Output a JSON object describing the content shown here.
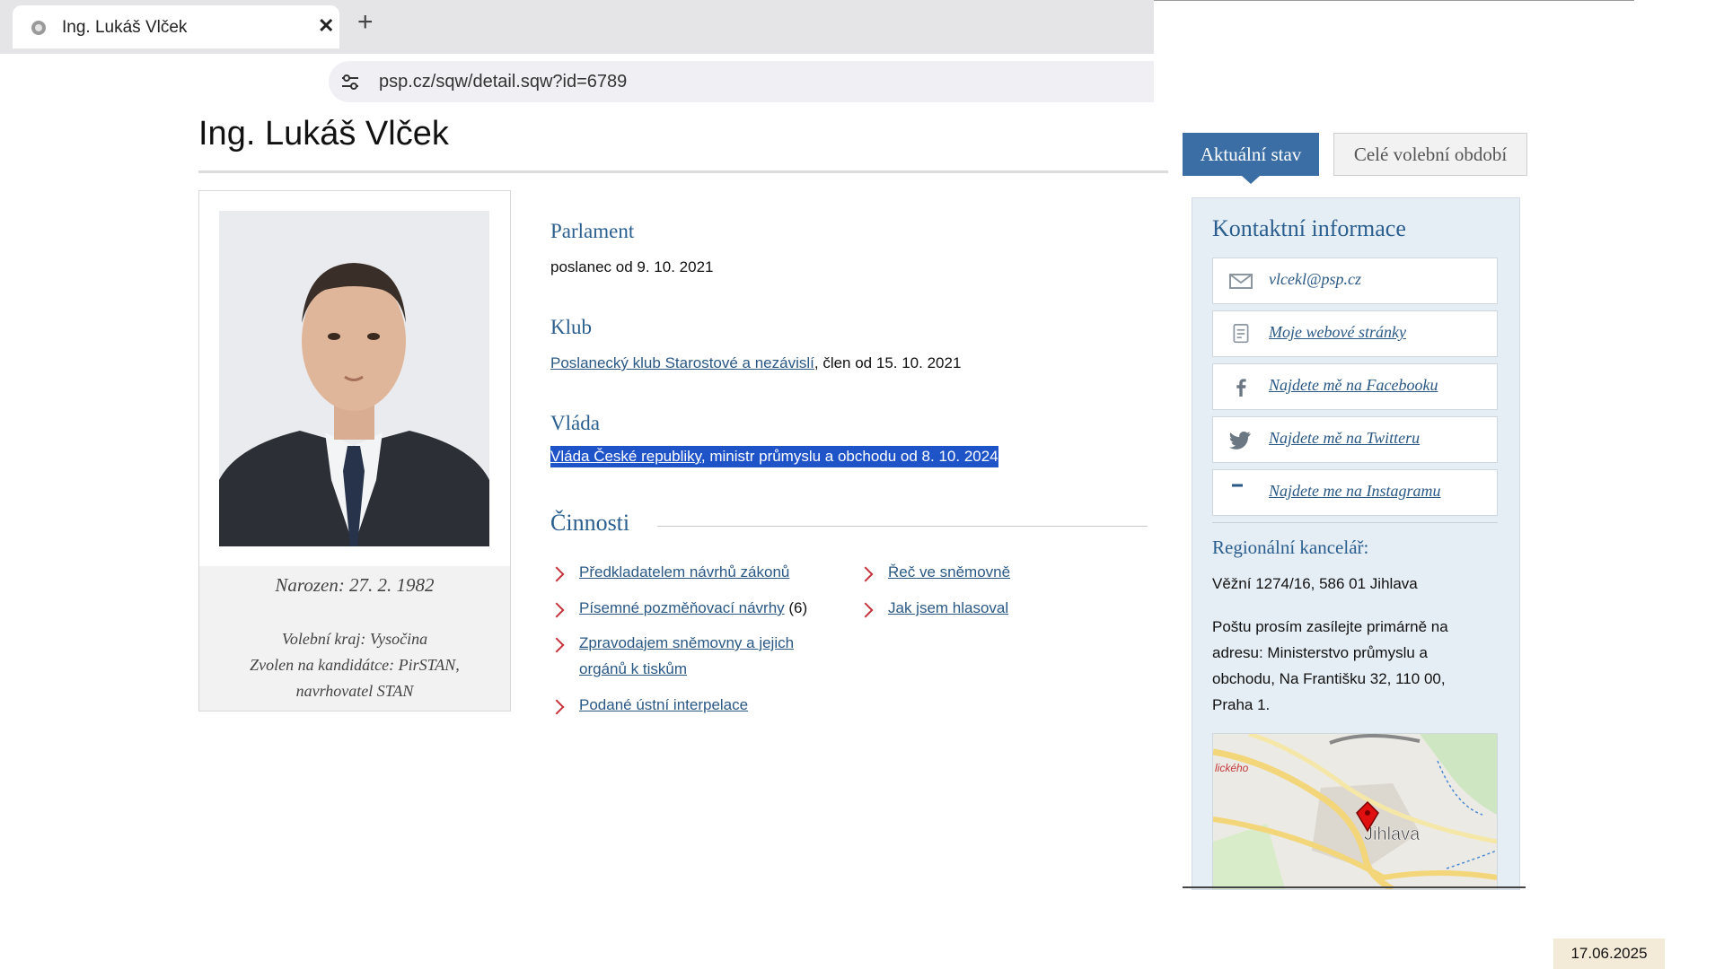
{
  "browser": {
    "tab_title": "Ing. Lukáš Vlček",
    "url": "psp.cz/sqw/detail.sqw?id=6789"
  },
  "page": {
    "title": "Ing. Lukáš Vlček"
  },
  "profile": {
    "born": "Narozen: 27. 2. 1982",
    "constituency": "Volební kraj: Vysočina",
    "candidate_of": "Zvolen na kandidátce: PirSTAN,",
    "nominated_by": "navrhovatel STAN"
  },
  "parliament": {
    "heading": "Parlament",
    "text": "poslanec od 9. 10. 2021"
  },
  "club": {
    "heading": "Klub",
    "link": "Poslanecký klub Starostové a nezávislí",
    "text": ", člen od 15. 10. 2021"
  },
  "government": {
    "heading": "Vláda",
    "link": "Vláda České republiky",
    "text": ", ministr průmyslu a obchodu od 8. 10. 2024"
  },
  "activities": {
    "heading": "Činnosti",
    "left": [
      {
        "label": "Předkladatelem návrhů zákonů",
        "suffix": ""
      },
      {
        "label": "Písemné pozměňovací návrhy",
        "suffix": " (6)"
      },
      {
        "label": "Zpravodajem sněmovny a jejich",
        "label2": "orgánů k tiskům",
        "suffix": ""
      },
      {
        "label": "Podané ústní interpelace",
        "suffix": ""
      }
    ],
    "right": [
      {
        "label": "Řeč ve sněmovně"
      },
      {
        "label": "Jak jsem hlasoval"
      }
    ]
  },
  "sidebar": {
    "tabs": [
      "Aktuální stav",
      "Celé volební období"
    ],
    "contact_heading": "Kontaktní informace",
    "contacts": [
      {
        "label": "vlcekl@psp.cz",
        "icon": "envelope-icon"
      },
      {
        "label": "Moje webové stránky",
        "icon": "document-icon"
      },
      {
        "label": "Najdete mě na Facebooku",
        "icon": "facebook-icon"
      },
      {
        "label": "Najdete mě na Twitteru",
        "icon": "twitter-icon"
      },
      {
        "label": "Najdete me na Instagramu",
        "icon": "instagram-icon"
      }
    ],
    "regional_heading": "Regionální kancelář:",
    "address": "Věžní 1274/16, 586 01  Jihlava",
    "note": "Poštu prosím zasílejte primárně na adresu: Ministerstvo průmyslu a obchodu, Na Františku 32, 110 00, Praha 1.",
    "map_labels": [
      "Jihlava",
      "lického"
    ]
  },
  "taskbar": {
    "date": "17.06.2025"
  },
  "colors": {
    "link": "#2a5885",
    "heading": "#2a5e8e",
    "accent_tab": "#3a6ea5",
    "chevron": "#c8323c",
    "selection": "#1f54c9"
  }
}
